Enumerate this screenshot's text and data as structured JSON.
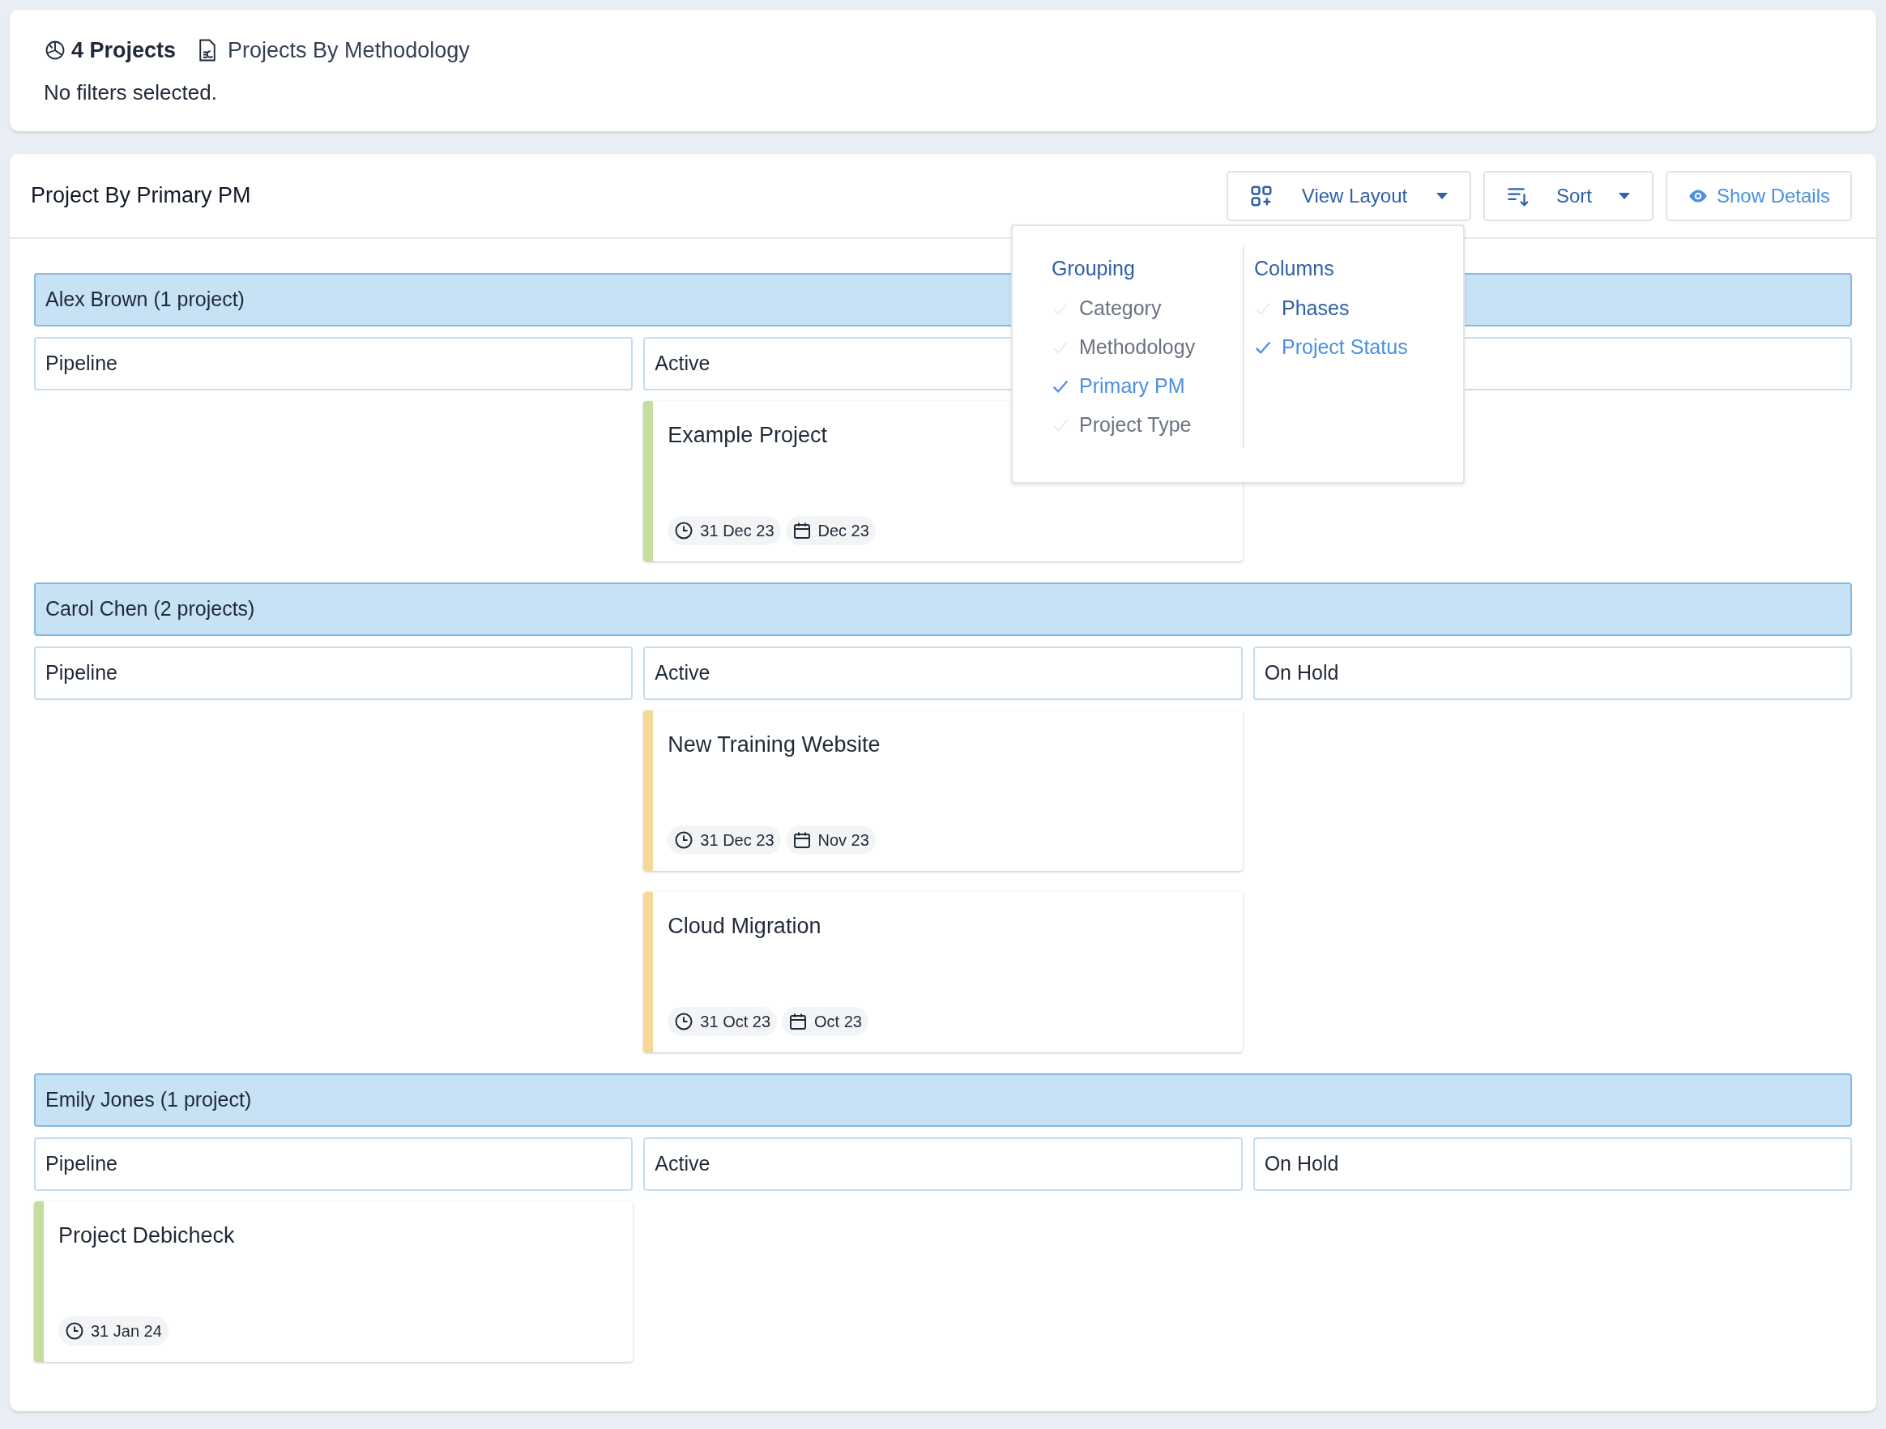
{
  "summary": {
    "count": "4 Projects",
    "report": "Projects By Methodology",
    "filters": "No filters selected."
  },
  "board": {
    "title": "Project By Primary PM",
    "buttons": [
      {
        "kind": "layout",
        "label": "View Layout"
      },
      {
        "kind": "sort",
        "label": "Sort"
      },
      {
        "kind": "details",
        "label": "Show Details"
      }
    ],
    "layout_menu": {
      "sections": [
        {
          "heading": "Grouping",
          "items": [
            {
              "label": "Category",
              "selected": false
            },
            {
              "label": "Methodology",
              "selected": false
            },
            {
              "label": "Primary PM",
              "selected": true
            },
            {
              "label": "Project Type",
              "selected": false
            }
          ]
        },
        {
          "heading": "Columns",
          "items": [
            {
              "label": "Phases",
              "selected": false
            },
            {
              "label": "Project Status",
              "selected": true
            }
          ]
        }
      ]
    },
    "groups": [
      {
        "name": "Alex Brown (1 project)",
        "columns": [
          {
            "label": "Pipeline"
          },
          {
            "label": "Active",
            "cards": [
              {
                "title": "Example Project",
                "color": "#c5dea0",
                "due": "31 Dec 23",
                "month": "Dec 23"
              }
            ]
          },
          {}
        ]
      },
      {
        "name": "Carol Chen (2 projects)",
        "columns": [
          {
            "label": "Pipeline"
          },
          {
            "label": "Active",
            "cards": [
              {
                "title": "New Training Website",
                "color": "#f7d996",
                "due": "31 Dec 23",
                "month": "Nov 23"
              },
              {
                "title": "Cloud Migration",
                "color": "#f7d996",
                "due": "31 Oct 23",
                "month": "Oct 23"
              }
            ]
          },
          {
            "label": "On Hold"
          }
        ]
      },
      {
        "name": "Emily Jones (1 project)",
        "columns": [
          {
            "label": "Pipeline",
            "cards": [
              {
                "title": "Project Debicheck",
                "color": "#c5dea0",
                "due": "31 Jan 24"
              }
            ]
          },
          {
            "label": "Active"
          },
          {
            "label": "On Hold"
          }
        ]
      }
    ]
  }
}
